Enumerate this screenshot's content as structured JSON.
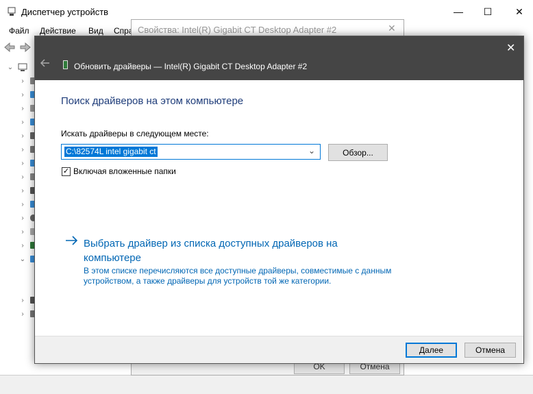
{
  "device_manager": {
    "title": "Диспетчер устройств",
    "menu": [
      "Файл",
      "Действие",
      "Вид",
      "Спра"
    ],
    "window_buttons": {
      "minimize": "—",
      "maximize": "☐",
      "close": "✕"
    }
  },
  "properties": {
    "title": "Свойства: Intel(R) Gigabit CT Desktop Adapter #2",
    "ok_label": "OK",
    "cancel_label": "Отмена"
  },
  "wizard": {
    "title": "Обновить драйверы — Intel(R) Gigabit CT Desktop Adapter #2",
    "heading": "Поиск драйверов на этом компьютере",
    "search_label": "Искать драйверы в следующем месте:",
    "path_value": "C:\\82574L intel gigabit ct",
    "browse_label": "Обзор...",
    "include_subfolders_label": "Включая вложенные папки",
    "include_subfolders_checked": true,
    "pick_link_line1": "Выбрать драйвер из списка доступных драйверов на",
    "pick_link_line2": "компьютере",
    "pick_desc_line1": "В этом списке перечисляются все доступные драйверы, совместимые с данным",
    "pick_desc_line2": "устройством, а также драйверы для устройств той же категории.",
    "next_label": "Далее",
    "cancel_label": "Отмена"
  },
  "colors": {
    "accent": "#0078d7",
    "link": "#0066b4",
    "header_bg": "#454545",
    "heading": "#1f3d7a"
  }
}
